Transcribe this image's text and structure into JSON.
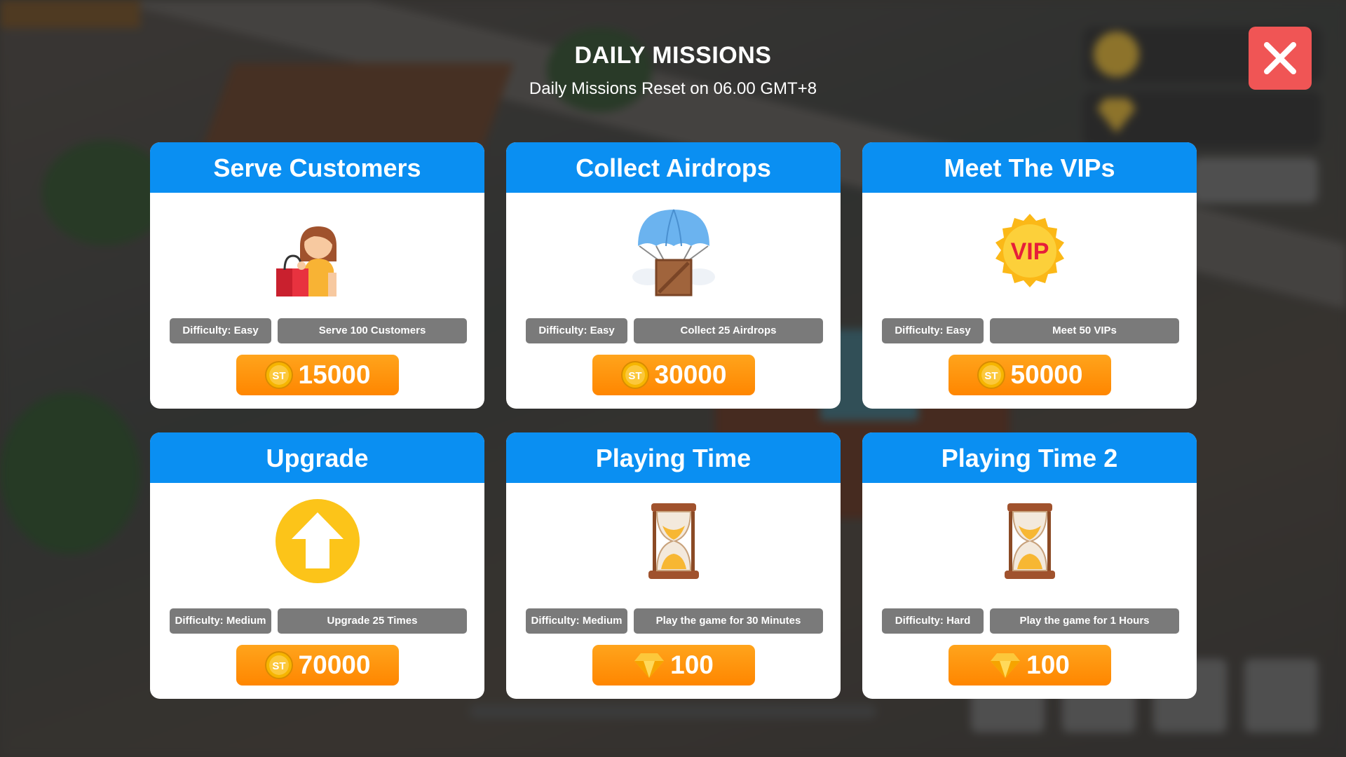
{
  "header": {
    "title": "DAILY MISSIONS",
    "subtitle": "Daily Missions Reset on 06.00 GMT+8"
  },
  "colors": {
    "card_header": "#0a8ff2",
    "pill": "#7a7a7a",
    "reward": "#ff9000",
    "close": "#f05555"
  },
  "missions": [
    {
      "title": "Serve Customers",
      "icon": "shopper-icon",
      "difficulty": "Difficulty: Easy",
      "goal": "Serve 100 Customers",
      "reward_icon": "st-coin-icon",
      "reward": "15000"
    },
    {
      "title": "Collect Airdrops",
      "icon": "airdrop-parachute-icon",
      "difficulty": "Difficulty: Easy",
      "goal": "Collect 25 Airdrops",
      "reward_icon": "st-coin-icon",
      "reward": "30000"
    },
    {
      "title": "Meet The VIPs",
      "icon": "vip-badge-icon",
      "difficulty": "Difficulty: Easy",
      "goal": "Meet 50 VIPs",
      "reward_icon": "st-coin-icon",
      "reward": "50000"
    },
    {
      "title": "Upgrade",
      "icon": "upgrade-arrow-icon",
      "difficulty": "Difficulty: Medium",
      "goal": "Upgrade 25 Times",
      "reward_icon": "st-coin-icon",
      "reward": "70000"
    },
    {
      "title": "Playing Time",
      "icon": "hourglass-icon",
      "difficulty": "Difficulty: Medium",
      "goal": "Play the game for 30 Minutes",
      "reward_icon": "diamond-icon",
      "reward": "100"
    },
    {
      "title": "Playing Time 2",
      "icon": "hourglass-icon",
      "difficulty": "Difficulty: Hard",
      "goal": "Play the game for 1 Hours",
      "reward_icon": "diamond-icon",
      "reward": "100"
    }
  ]
}
